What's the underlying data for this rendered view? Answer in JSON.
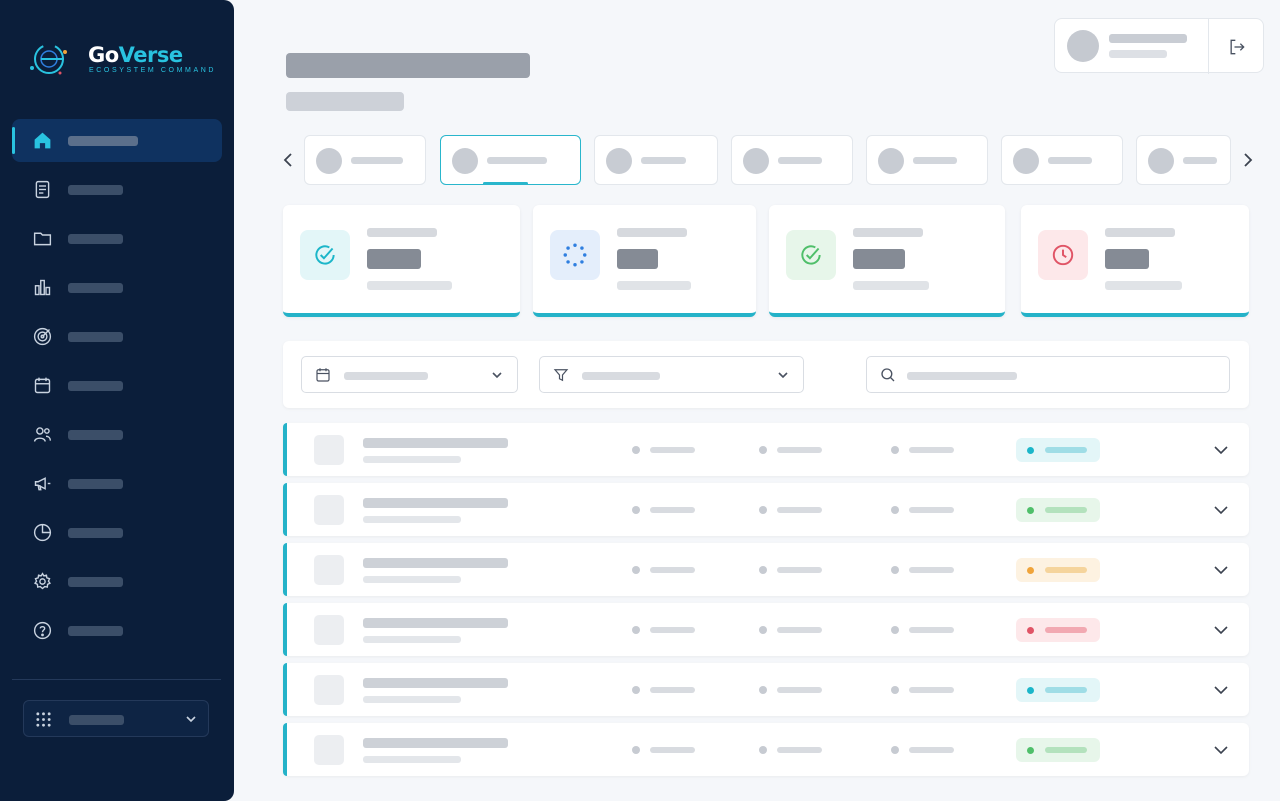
{
  "brand": {
    "name_part1": "Go",
    "name_part2": "Verse",
    "tagline": "ECOSYSTEM COMMAND"
  },
  "colors": {
    "sidebar_bg": "#0b1e3a",
    "accent": "#29c3e0",
    "teal": "#24b2c8",
    "status_teal": "#1bb6c9",
    "status_green": "#4fbf6a",
    "status_orange": "#f0a43a",
    "status_red": "#e05466"
  },
  "sidebar": {
    "items": [
      {
        "icon": "home-icon",
        "active": true
      },
      {
        "icon": "document-icon",
        "active": false
      },
      {
        "icon": "folder-icon",
        "active": false
      },
      {
        "icon": "bar-chart-icon",
        "active": false
      },
      {
        "icon": "target-icon",
        "active": false
      },
      {
        "icon": "calendar-icon",
        "active": false
      },
      {
        "icon": "users-icon",
        "active": false
      },
      {
        "icon": "megaphone-icon",
        "active": false
      },
      {
        "icon": "pie-chart-icon",
        "active": false
      },
      {
        "icon": "gear-icon",
        "active": false
      },
      {
        "icon": "help-icon",
        "active": false
      }
    ],
    "workspace_switcher": {
      "icon": "grid-icon",
      "chevron": "chevron-down-icon"
    }
  },
  "header": {
    "user_menu": {
      "avatar": "avatar",
      "logout_icon": "logout-icon"
    }
  },
  "tabs": {
    "prev_icon": "chevron-left-icon",
    "next_icon": "chevron-right-icon",
    "count": 7,
    "active_index": 1
  },
  "stat_cards": [
    {
      "icon": "check-circle-icon",
      "icon_color": "#1bb6c9",
      "icon_bg": "#e3f6f8"
    },
    {
      "icon": "loading-icon",
      "icon_color": "#2f7fe0",
      "icon_bg": "#e4eefb"
    },
    {
      "icon": "check-circle-icon",
      "icon_color": "#4fbf6a",
      "icon_bg": "#e7f6ea"
    },
    {
      "icon": "clock-icon",
      "icon_color": "#e05466",
      "icon_bg": "#fde8ea"
    }
  ],
  "filters": {
    "date_icon": "calendar-icon",
    "filter_icon": "filter-icon",
    "search_icon": "search-icon"
  },
  "rows": [
    {
      "status": "teal"
    },
    {
      "status": "green"
    },
    {
      "status": "orange"
    },
    {
      "status": "red"
    },
    {
      "status": "teal"
    },
    {
      "status": "green"
    }
  ]
}
